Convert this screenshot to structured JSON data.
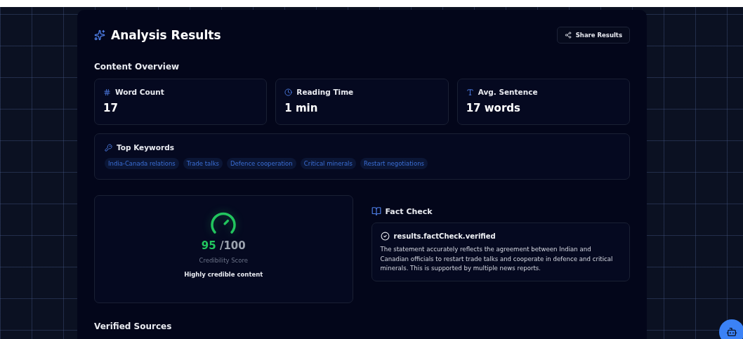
{
  "header": {
    "title": "Analysis Results",
    "share_button": "Share Results"
  },
  "overview": {
    "heading": "Content Overview",
    "stats": [
      {
        "kind": "hash",
        "label": "Word Count",
        "value": "17"
      },
      {
        "kind": "clock",
        "label": "Reading Time",
        "value": "1 min"
      },
      {
        "kind": "type",
        "label": "Avg. Sentence",
        "value": "17 words"
      }
    ]
  },
  "keywords": {
    "heading": "Top Keywords",
    "items": [
      "India-Canada relations",
      "Trade talks",
      "Defence cooperation",
      "Critical minerals",
      "Restart negotiations"
    ]
  },
  "credibility": {
    "score": "95",
    "max": "/100",
    "label": "Credibility Score",
    "verdict": "Highly credible content"
  },
  "fact_check": {
    "heading": "Fact Check",
    "status": "results.factCheck.verified",
    "text": "The statement accurately reflects the agreement between Indian and Canadian officials to restart trade talks and cooperate in defence and critical minerals. This is supported by multiple news reports."
  },
  "sources": {
    "heading": "Verified Sources"
  }
}
